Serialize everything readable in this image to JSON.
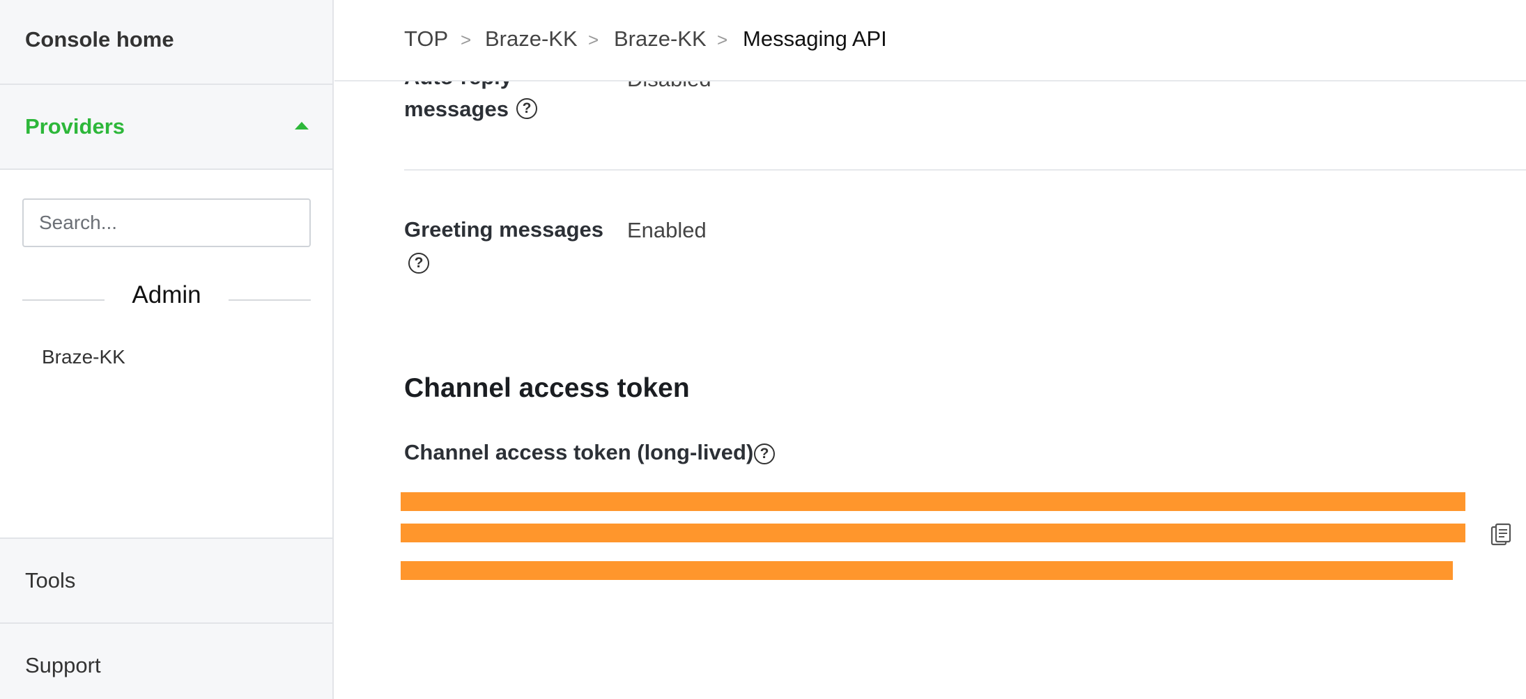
{
  "sidebar": {
    "console_home": "Console home",
    "providers": "Providers",
    "search": {
      "placeholder": "Search..."
    },
    "group_label": "Admin",
    "items": [
      {
        "label": "Braze-KK"
      }
    ],
    "tools": "Tools",
    "support": "Support"
  },
  "breadcrumb": {
    "items": [
      "TOP",
      "Braze-KK",
      "Braze-KK",
      "Messaging API"
    ],
    "separator": ">"
  },
  "settings": {
    "auto_reply": {
      "label_line1": "Auto-reply",
      "label_line2": "messages",
      "value": "Disabled"
    },
    "greeting": {
      "label": "Greeting messages",
      "value": "Enabled"
    }
  },
  "channel_access_token": {
    "section_title": "Channel access token",
    "label": "Channel access token (long-lived)"
  },
  "colors": {
    "accent_green": "#2db73a",
    "redaction_orange": "#ff962c"
  }
}
